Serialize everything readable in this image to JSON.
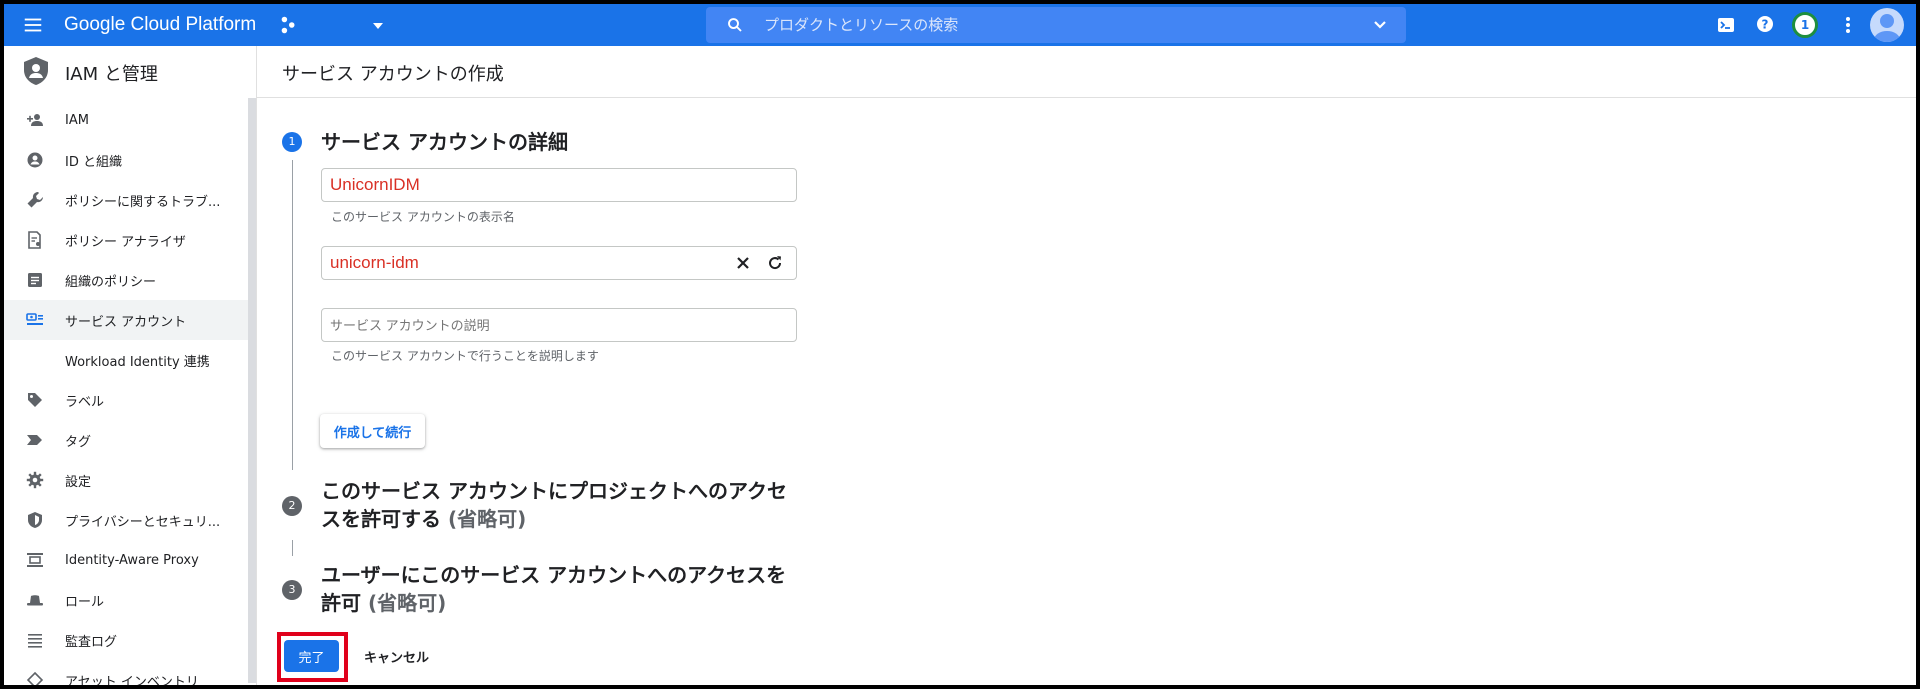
{
  "topbar": {
    "brand": "Google Cloud Platform",
    "search_placeholder": "プロダクトとリソースの検索",
    "notification_count": "1"
  },
  "sidebar": {
    "title": "IAM と管理",
    "items": [
      {
        "label": "IAM",
        "icon": "person-add-icon"
      },
      {
        "label": "ID と組織",
        "icon": "account-circle-icon"
      },
      {
        "label": "ポリシーに関するトラブ...",
        "icon": "wrench-icon"
      },
      {
        "label": "ポリシー アナライザ",
        "icon": "policy-analyzer-icon"
      },
      {
        "label": "組織のポリシー",
        "icon": "list-box-icon"
      },
      {
        "label": "サービス アカウント",
        "icon": "service-account-icon",
        "active": true
      },
      {
        "label": "Workload Identity 連携",
        "icon": ""
      },
      {
        "label": "ラベル",
        "icon": "label-tag-icon"
      },
      {
        "label": "タグ",
        "icon": "tag-arrow-icon"
      },
      {
        "label": "設定",
        "icon": "gear-icon"
      },
      {
        "label": "プライバシーとセキュリ...",
        "icon": "shield-icon"
      },
      {
        "label": "Identity-Aware Proxy",
        "icon": "iap-icon"
      },
      {
        "label": "ロール",
        "icon": "hat-icon"
      },
      {
        "label": "監査ログ",
        "icon": "lines-icon"
      },
      {
        "label": "アセット インベントリ",
        "icon": "diamond-icon"
      }
    ]
  },
  "main": {
    "page_title": "サービス アカウントの作成",
    "step1": {
      "number": "1",
      "title": "サービス アカウントの詳細",
      "display_name_value": "UnicornIDM",
      "display_name_hint": "このサービス アカウントの表示名",
      "account_id_value": "unicorn-idm",
      "description_placeholder": "サービス アカウントの説明",
      "description_hint": "このサービス アカウントで行うことを説明します",
      "create_continue_label": "作成して続行"
    },
    "step2": {
      "number": "2",
      "title_line1": "このサービス アカウントにプロジェクトへのアクセ",
      "title_line2": "スを許可する",
      "optional": "(省略可)"
    },
    "step3": {
      "number": "3",
      "title_line1": "ユーザーにこのサービス アカウントへのアクセスを",
      "title_line2": "許可",
      "optional": "(省略可)"
    },
    "done_label": "完了",
    "cancel_label": "キャンセル"
  },
  "colors": {
    "brand_blue": "#1a73e8",
    "highlight_red": "#e0001b",
    "value_red": "#d93025",
    "step_active": "#1a73e8",
    "step_inactive": "#5f6368"
  }
}
